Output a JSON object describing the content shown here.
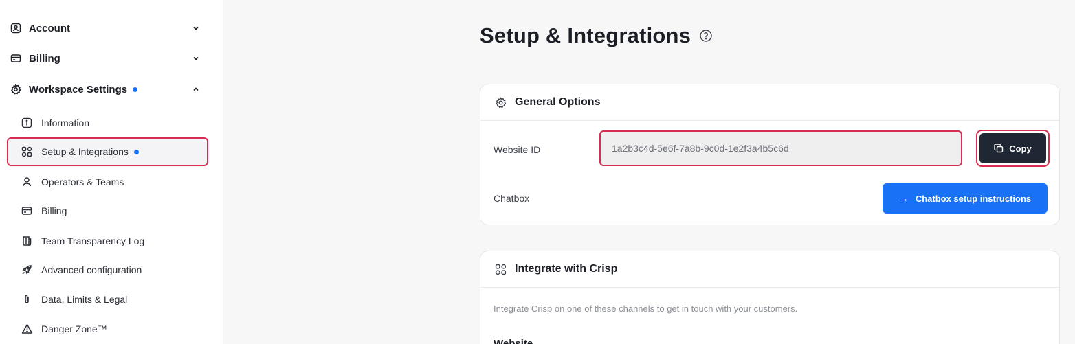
{
  "sidebar": {
    "top_items": [
      {
        "label": "Account",
        "icon": "user-square-icon",
        "expanded": false
      },
      {
        "label": "Billing",
        "icon": "credit-card-icon",
        "expanded": false
      },
      {
        "label": "Workspace Settings",
        "icon": "gear-icon",
        "expanded": true,
        "has_dot": true
      }
    ],
    "sub_items": [
      {
        "label": "Information",
        "icon": "info-icon"
      },
      {
        "label": "Setup & Integrations",
        "icon": "grid-icon",
        "active": true,
        "has_dot": true
      },
      {
        "label": "Operators & Teams",
        "icon": "person-icon"
      },
      {
        "label": "Billing",
        "icon": "credit-card-icon"
      },
      {
        "label": "Team Transparency Log",
        "icon": "log-icon"
      },
      {
        "label": "Advanced configuration",
        "icon": "rocket-icon"
      },
      {
        "label": "Data, Limits & Legal",
        "icon": "paperclip-icon"
      },
      {
        "label": "Danger Zone™",
        "icon": "warning-icon"
      }
    ]
  },
  "main": {
    "title": "Setup & Integrations",
    "general_options": {
      "title": "General Options",
      "website_id_label": "Website ID",
      "website_id_value": "1a2b3c4d-5e6f-7a8b-9c0d-1e2f3a4b5c6d",
      "copy_label": "Copy",
      "chatbox_label": "Chatbox",
      "chatbox_button_label": "Chatbox setup instructions"
    },
    "integrate": {
      "title": "Integrate with Crisp",
      "description": "Integrate Crisp on one of these channels to get in touch with your customers.",
      "subsection": "Website"
    }
  },
  "colors": {
    "accent": "#1972f5",
    "highlight": "#d62d51",
    "dark_button": "#1f2735"
  }
}
